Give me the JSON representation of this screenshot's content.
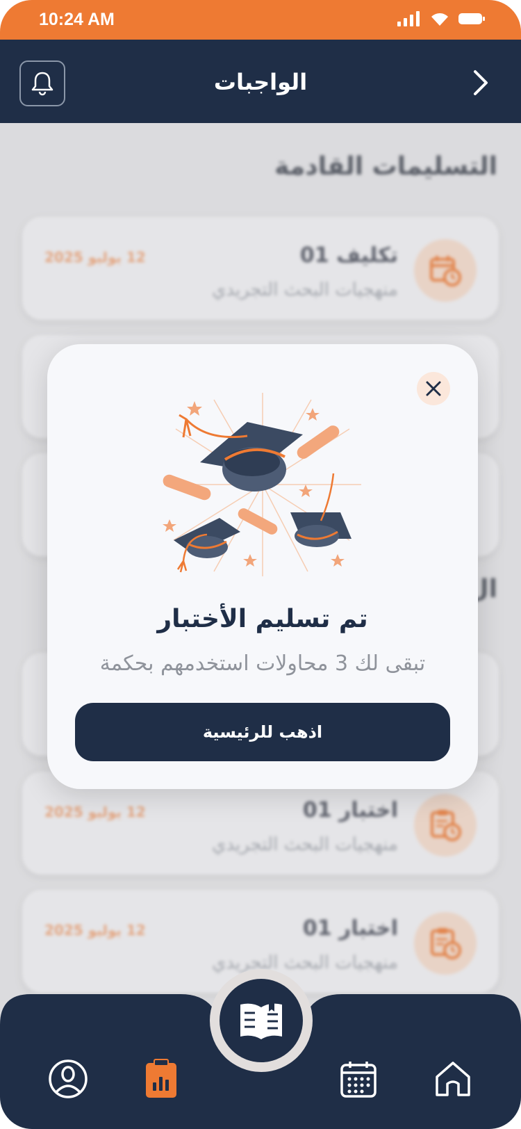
{
  "status_bar": {
    "time": "10:24 AM"
  },
  "header": {
    "title": "الواجبات"
  },
  "sections": [
    {
      "title": "التسليمات القادمة"
    },
    {
      "title": "ال"
    }
  ],
  "cards": [
    {
      "title": "تكليف 01",
      "subtitle": "منهجيات البحث التجريدي",
      "date": "12 يوليو 2025",
      "icon": "calendar-clock-icon"
    },
    {
      "title": "",
      "subtitle": "",
      "date": "",
      "icon": ""
    },
    {
      "title": "",
      "subtitle": "",
      "date": "",
      "icon": ""
    },
    {
      "title": "",
      "subtitle": "",
      "date": "",
      "icon": ""
    },
    {
      "title": "اختبار 01",
      "subtitle": "منهجيات البحث التجريدي",
      "date": "12 يوليو 2025",
      "icon": "clipboard-clock-icon"
    },
    {
      "title": "اختبار 01",
      "subtitle": "منهجيات البحث التجريدي",
      "date": "12 يوليو 2025",
      "icon": "clipboard-clock-icon"
    }
  ],
  "modal": {
    "title": "تم تسليم الأختبار",
    "subtitle": "تبقى لك 3 محاولات استخدمهم بحكمة",
    "button_label": "اذهب للرئيسية",
    "illustration": "graduation-caps-diplomas-illustration"
  },
  "nav": {
    "items": [
      "profile-icon",
      "reports-icon",
      "book-icon",
      "calendar-icon",
      "home-icon"
    ],
    "active": "reports-icon"
  },
  "colors": {
    "accent": "#ee7a33",
    "navy": "#1f2e47",
    "modal_bg": "#f7f8fb"
  }
}
